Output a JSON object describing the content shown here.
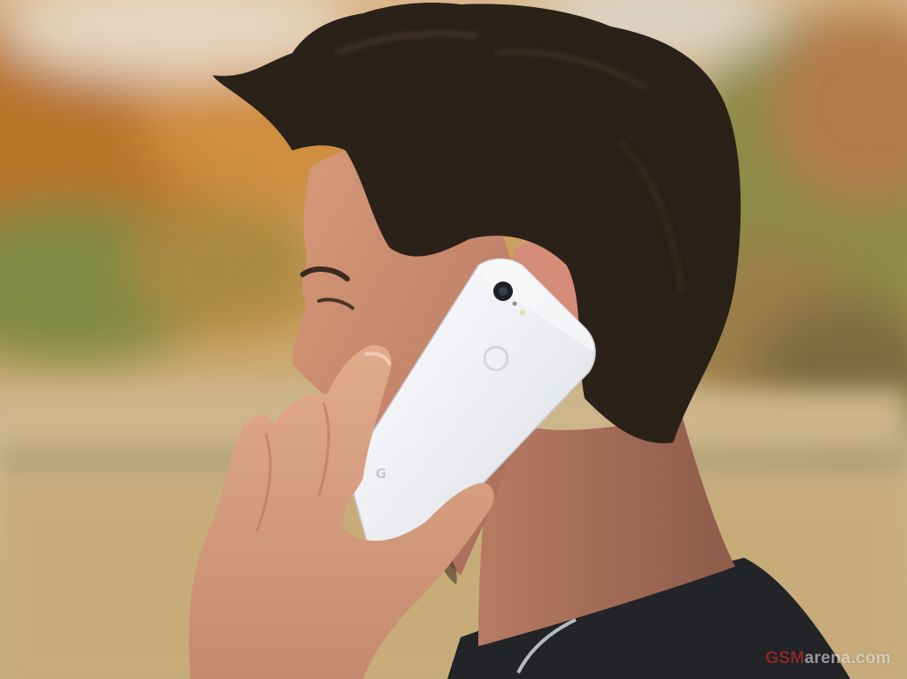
{
  "image": {
    "watermark": {
      "red_part": "GSM",
      "rest_part": "arena.com"
    },
    "phone": {
      "logo_glyph": "G"
    },
    "colors": {
      "background_warm": "#c98a3e",
      "background_grass": "#c9b58c",
      "foliage_green": "#7f8a45",
      "hair": "#2a2119",
      "skin": "#c88a6a",
      "phone_body": "#eef0f3",
      "shirt": "#222326"
    }
  }
}
